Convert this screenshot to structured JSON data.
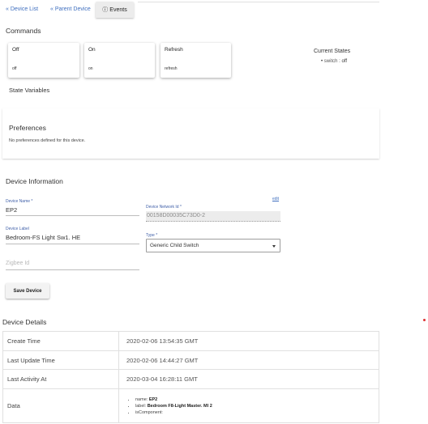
{
  "nav": {
    "device_list": "« Device List",
    "parent_device": "« Parent Device",
    "events_icon": "ⓘ",
    "events": "Events"
  },
  "commands": {
    "title": "Commands",
    "items": [
      {
        "name": "Off",
        "arg": "off"
      },
      {
        "name": "On",
        "arg": "on"
      },
      {
        "name": "Refresh",
        "arg": "refresh"
      }
    ]
  },
  "current_states": {
    "title": "Current States",
    "items": [
      {
        "key": "switch",
        "value": "off"
      }
    ]
  },
  "state_variables": {
    "title": "State Variables"
  },
  "preferences": {
    "title": "Preferences",
    "empty_text": "No preferences defined for this device."
  },
  "device_info": {
    "title": "Device Information",
    "name_label": "Device Name *",
    "name_value": "EP2",
    "label_label": "Device Label",
    "label_value": "Bedroom-FS Light Sw1. HE",
    "zigbee_placeholder": "Zigbee Id",
    "dni_label": "Device Network Id *",
    "dni_value": "00158D00035C73D0-2",
    "edit_link": "edit",
    "type_label": "Type *",
    "type_value": "Generic Child Switch",
    "save_button": "Save Device"
  },
  "device_details": {
    "title": "Device Details",
    "rows": [
      {
        "key": "Create Time",
        "value": "2020-02-06 13:54:35 GMT"
      },
      {
        "key": "Last Update Time",
        "value": "2020-02-06 14:44:27 GMT"
      },
      {
        "key": "Last Activity At",
        "value": "2020-03-04 16:28:11 GMT"
      }
    ],
    "data_key": "Data",
    "data_items": [
      {
        "key": "name",
        "value": "EP2"
      },
      {
        "key": "label",
        "value": "Bedroom F8-Light Master. MI 2"
      },
      {
        "key": "isComponent",
        "value": ""
      }
    ]
  },
  "colors": {
    "link": "#3f6fbf",
    "label": "#3f5fa8"
  }
}
